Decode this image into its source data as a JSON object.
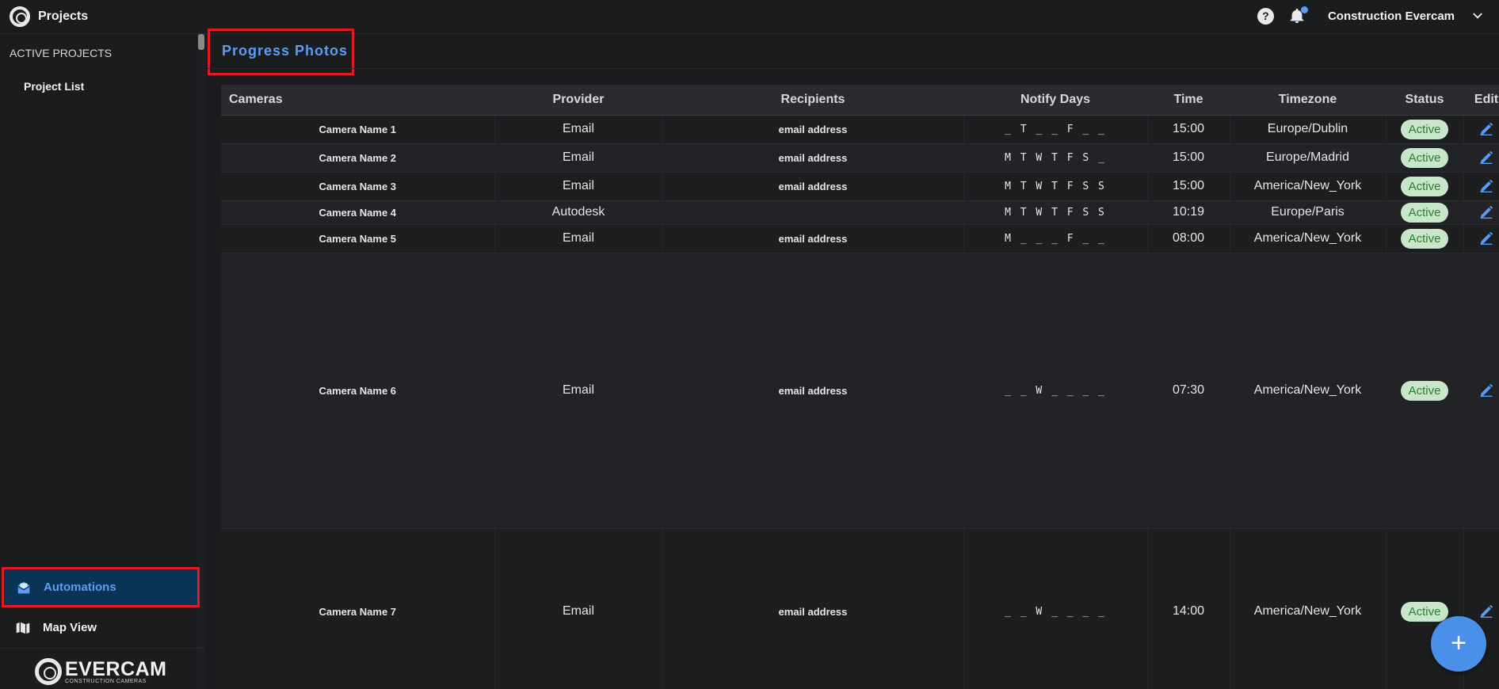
{
  "topbar": {
    "title": "Projects",
    "help_glyph": "?",
    "user_name": "Construction Evercam"
  },
  "sidebar": {
    "section_label": "ACTIVE PROJECTS",
    "project_list_label": "Project List",
    "items": [
      {
        "label": "Automations",
        "icon": "mail-open-icon",
        "active": true
      },
      {
        "label": "Map View",
        "icon": "map-icon",
        "active": false
      }
    ],
    "footer_logo": {
      "name": "EVERCAM",
      "tagline": "CONSTRUCTION CAMERAS"
    }
  },
  "main": {
    "page_title": "Progress Photos",
    "table": {
      "headers": [
        "Cameras",
        "Provider",
        "Recipients",
        "Notify Days",
        "Time",
        "Timezone",
        "Status",
        "Edit"
      ],
      "rows": [
        {
          "camera": "Camera Name 1",
          "provider": "Email",
          "recipients": "email address",
          "days": "_ T _ _ F _ _",
          "time": "15:00",
          "timezone": "Europe/Dublin",
          "status": "Active"
        },
        {
          "camera": "Camera Name 2",
          "provider": "Email",
          "recipients": "email address",
          "days": "M T W T F S _",
          "time": "15:00",
          "timezone": "Europe/Madrid",
          "status": "Active"
        },
        {
          "camera": "Camera Name 3",
          "provider": "Email",
          "recipients": "email address",
          "days": "M T W T F S S",
          "time": "15:00",
          "timezone": "America/New_York",
          "status": "Active"
        },
        {
          "camera": "Camera Name 4",
          "provider": "Autodesk",
          "recipients": "",
          "days": "M T W T F S S",
          "time": "10:19",
          "timezone": "Europe/Paris",
          "status": "Active"
        },
        {
          "camera": "Camera Name 5",
          "provider": "Email",
          "recipients": "email address",
          "days": "M _ _ _ F _ _",
          "time": "08:00",
          "timezone": "America/New_York",
          "status": "Active"
        },
        {
          "camera": "Camera Name 6",
          "provider": "Email",
          "recipients": "email address",
          "days": "_ _ W _ _ _ _",
          "time": "07:30",
          "timezone": "America/New_York",
          "status": "Active"
        },
        {
          "camera": "Camera Name 7",
          "provider": "Email",
          "recipients": "email address",
          "days": "_ _ W _ _ _ _",
          "time": "14:00",
          "timezone": "America/New_York",
          "status": "Active"
        }
      ]
    },
    "fab_label": "+"
  },
  "colors": {
    "accent": "#5b9cf5",
    "highlight_border": "#e01b24",
    "status_bg": "#c8e6c9",
    "status_text": "#2e7d32"
  }
}
